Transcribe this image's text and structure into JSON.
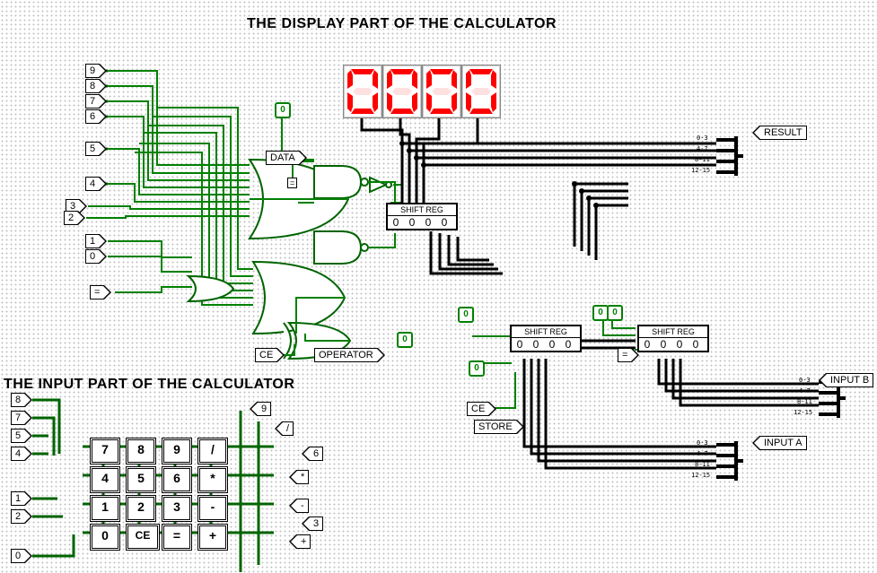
{
  "titles": {
    "display": "THE DISPLAY PART OF THE CALCULATOR",
    "input": "THE INPUT PART OF THE CALCULATOR"
  },
  "pins_display_numbers": [
    "9",
    "8",
    "7",
    "6",
    "5",
    "4",
    "3",
    "2",
    "1",
    "0"
  ],
  "pin_eq": "=",
  "pin_data": "DATA",
  "pin_ce_upper": "CE",
  "pin_operator": "OPERATOR",
  "pin_result": "RESULT",
  "pin_input_a": "INPUT A",
  "pin_input_b": "INPUT B",
  "pin_store": "STORE",
  "pin_ce_mid": "CE",
  "pin_eq_mid": "=",
  "const_zero": "0",
  "shiftreg": {
    "head": "SHIFT REG",
    "body": "0 0 0 0"
  },
  "splitter": {
    "a": "0-3",
    "b": "4-7",
    "c": "8-11",
    "d": "12-15"
  },
  "seg7_val": "0",
  "input_section": {
    "left_pins": [
      "8",
      "7",
      "5",
      "4",
      "1",
      "2",
      "0"
    ],
    "mid_pins_top": "9",
    "right_arrow_pins": [
      "/",
      "6",
      "*",
      "-",
      "3",
      "+"
    ],
    "keys_row1": [
      "7",
      "8",
      "9",
      "/"
    ],
    "keys_row2": [
      "4",
      "5",
      "6",
      "*"
    ],
    "keys_row3": [
      "1",
      "2",
      "3",
      "-"
    ],
    "keys_row4": [
      "0",
      "CE",
      "=",
      "+"
    ]
  }
}
